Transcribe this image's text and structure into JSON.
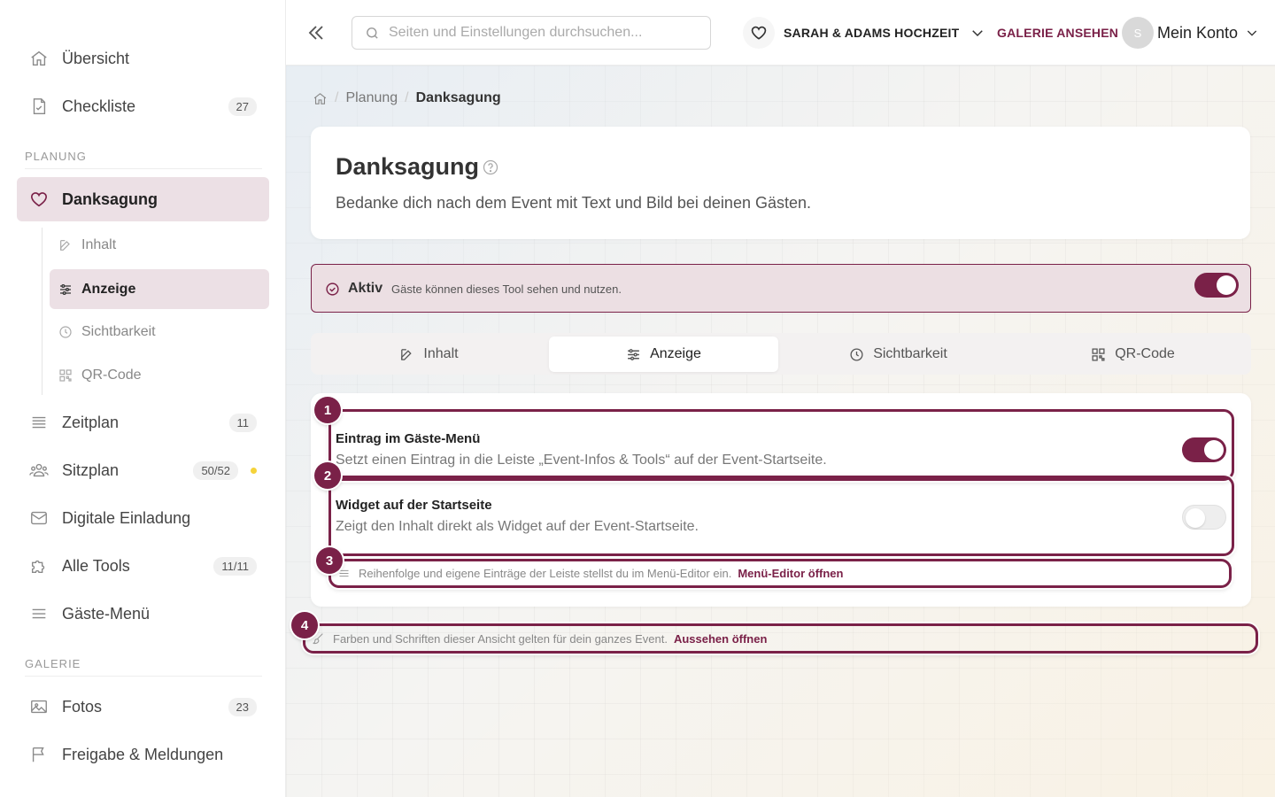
{
  "sidebar": {
    "items_top": [
      {
        "label": "Übersicht",
        "icon": "home-icon"
      },
      {
        "label": "Checkliste",
        "icon": "checklist-icon",
        "count": "27"
      }
    ],
    "section_planning": "PLANUNG",
    "active_item": {
      "label": "Danksagung",
      "icon": "heart-icon"
    },
    "subitems": [
      {
        "label": "Inhalt",
        "icon": "edit-icon"
      },
      {
        "label": "Anzeige",
        "icon": "sliders-icon"
      },
      {
        "label": "Sichtbarkeit",
        "icon": "clock-icon"
      },
      {
        "label": "QR-Code",
        "icon": "qr-icon"
      }
    ],
    "items_planning": [
      {
        "label": "Zeitplan",
        "icon": "list-icon",
        "count": "11"
      },
      {
        "label": "Sitzplan",
        "icon": "users-icon",
        "count": "50/52"
      },
      {
        "label": "Digitale Einladung",
        "icon": "mail-icon"
      },
      {
        "label": "Alle Tools",
        "icon": "puzzle-icon",
        "count": "11/11"
      },
      {
        "label": "Gäste-Menü",
        "icon": "menu-icon"
      }
    ],
    "section_gallery": "GALERIE",
    "items_gallery": [
      {
        "label": "Fotos",
        "icon": "image-icon",
        "count": "23"
      },
      {
        "label": "Freigabe & Meldungen",
        "icon": "flag-icon"
      }
    ]
  },
  "topbar": {
    "search_placeholder": "Seiten und Einstellungen durchsuchen...",
    "event_name": "SARAH & ADAMS HOCHZEIT",
    "gallery_link": "GALERIE ANSEHEN",
    "avatar_initial": "S",
    "account_label": "Mein Konto"
  },
  "breadcrumb": {
    "parent": "Planung",
    "current": "Danksagung"
  },
  "header": {
    "title": "Danksagung",
    "description": "Bedanke dich nach dem Event mit Text und Bild bei deinen Gästen."
  },
  "active_status": {
    "title": "Aktiv",
    "description": "Gäste können dieses Tool sehen und nutzen.",
    "enabled": true
  },
  "tabs": [
    {
      "label": "Inhalt",
      "icon": "edit-icon"
    },
    {
      "label": "Anzeige",
      "icon": "sliders-icon"
    },
    {
      "label": "Sichtbarkeit",
      "icon": "clock-icon"
    },
    {
      "label": "QR-Code",
      "icon": "qr-icon"
    }
  ],
  "active_tab": "Anzeige",
  "settings": {
    "menu_entry": {
      "title": "Eintrag im Gäste-Menü",
      "description": "Setzt einen Eintrag in die Leiste „Event-Infos & Tools“ auf der Event-Startseite.",
      "enabled": true
    },
    "widget": {
      "title": "Widget auf der Startseite",
      "description": "Zeigt den Inhalt direkt als Widget auf der Event-Startseite.",
      "enabled": false
    },
    "menu_hint": {
      "text": "Reihenfolge und eigene Einträge der Leiste stellst du im Menü-Editor ein.",
      "link": "Menü-Editor öffnen"
    }
  },
  "appearance_hint": {
    "text": "Farben und Schriften dieser Ansicht gelten für dein ganzes Event.",
    "link": "Aussehen öffnen"
  },
  "annotations": [
    "1",
    "2",
    "3",
    "4"
  ],
  "colors": {
    "accent": "#7a2148",
    "active_bg": "#ece0e5",
    "count_dot": "#f5d33a"
  }
}
